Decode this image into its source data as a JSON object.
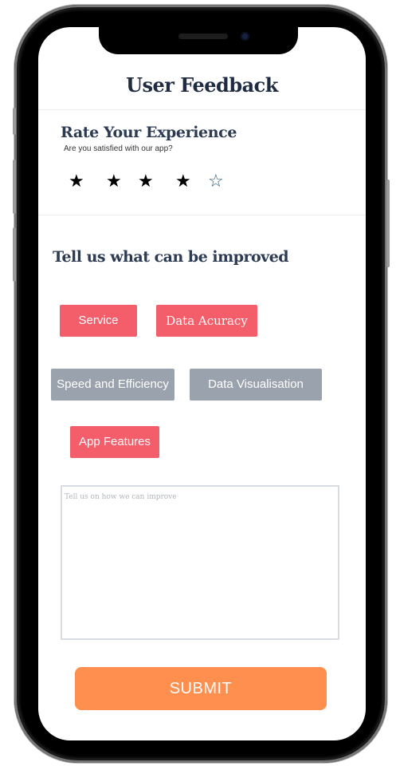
{
  "header": {
    "title": "User Feedback"
  },
  "rating": {
    "title": "Rate Your Experience",
    "subtitle": "Are you satisfied with our app?",
    "value": 4,
    "max": 5,
    "filled_glyph": "★",
    "empty_glyph": "☆"
  },
  "improvement": {
    "title": "Tell us what can be improved",
    "options": [
      {
        "label": "Service",
        "selected": true
      },
      {
        "label": "Data Acuracy",
        "selected": true
      },
      {
        "label": "Speed and Efficiency",
        "selected": false
      },
      {
        "label": "Data Visualisation",
        "selected": false
      },
      {
        "label": "App Features",
        "selected": true
      }
    ],
    "comment_placeholder": "Tell us on how we can improve",
    "comment_value": ""
  },
  "submit_label": "SUBMIT",
  "colors": {
    "selected_chip": "#f45d6a",
    "unselected_chip": "#9aa3ad",
    "submit": "#ff8f4f",
    "heading": "#1f2b40"
  }
}
